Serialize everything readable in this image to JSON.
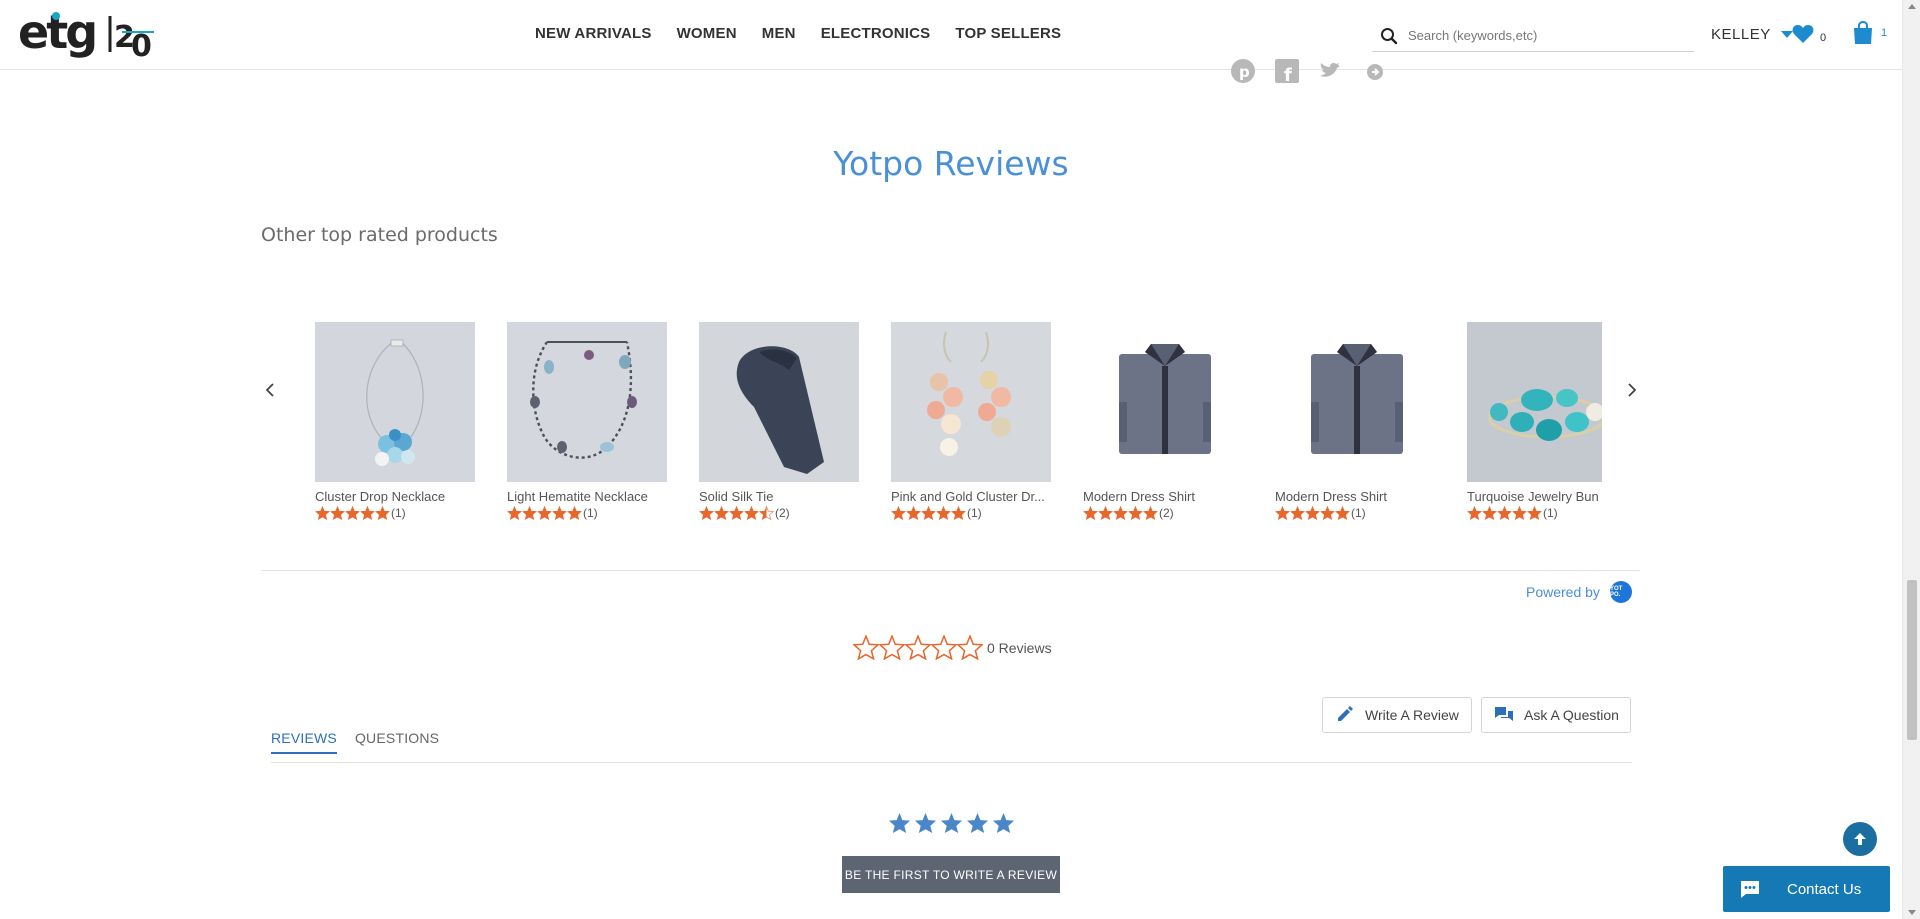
{
  "header": {
    "logo_text": "etg 20",
    "nav": [
      "NEW ARRIVALS",
      "WOMEN",
      "MEN",
      "ELECTRONICS",
      "TOP SELLERS"
    ],
    "search_placeholder": "Search (keywords,etc)",
    "user_name": "KELLEY",
    "wishlist_count": "0",
    "cart_count": "1"
  },
  "share_icons": [
    "pinterest-icon",
    "facebook-icon",
    "twitter-icon",
    "link-icon"
  ],
  "reviews": {
    "title": "Yotpo Reviews",
    "subtitle": "Other top rated products",
    "products": [
      {
        "name": "Cluster Drop Necklace",
        "rating": 5,
        "count": "(1)"
      },
      {
        "name": "Light Hematite Necklace",
        "rating": 5,
        "count": "(1)"
      },
      {
        "name": "Solid Silk Tie",
        "rating": 4.5,
        "count": "(2)"
      },
      {
        "name": "Pink and Gold Cluster Dr...",
        "rating": 5,
        "count": "(1)"
      },
      {
        "name": "Modern Dress Shirt",
        "rating": 5,
        "count": "(2)"
      },
      {
        "name": "Modern Dress Shirt",
        "rating": 5,
        "count": "(1)"
      },
      {
        "name": "Turquoise Jewelry Bun",
        "rating": 5,
        "count": "(1)"
      }
    ],
    "powered_by": "Powered by",
    "yotpo_badge": "YOT PO.",
    "summary_rating": 0,
    "summary_text": "0 Reviews",
    "write_review": "Write A Review",
    "ask_question": "Ask A Question",
    "tabs": [
      "REVIEWS",
      "QUESTIONS"
    ],
    "active_tab": "REVIEWS",
    "first_review_btn": "BE THE FIRST TO WRITE A REVIEW"
  },
  "contact_us": "Contact Us",
  "colors": {
    "accent_blue": "#4a90d9",
    "star_orange": "#e8672b",
    "star_blue": "#4a86c8",
    "contact_bg": "#1579b6"
  }
}
